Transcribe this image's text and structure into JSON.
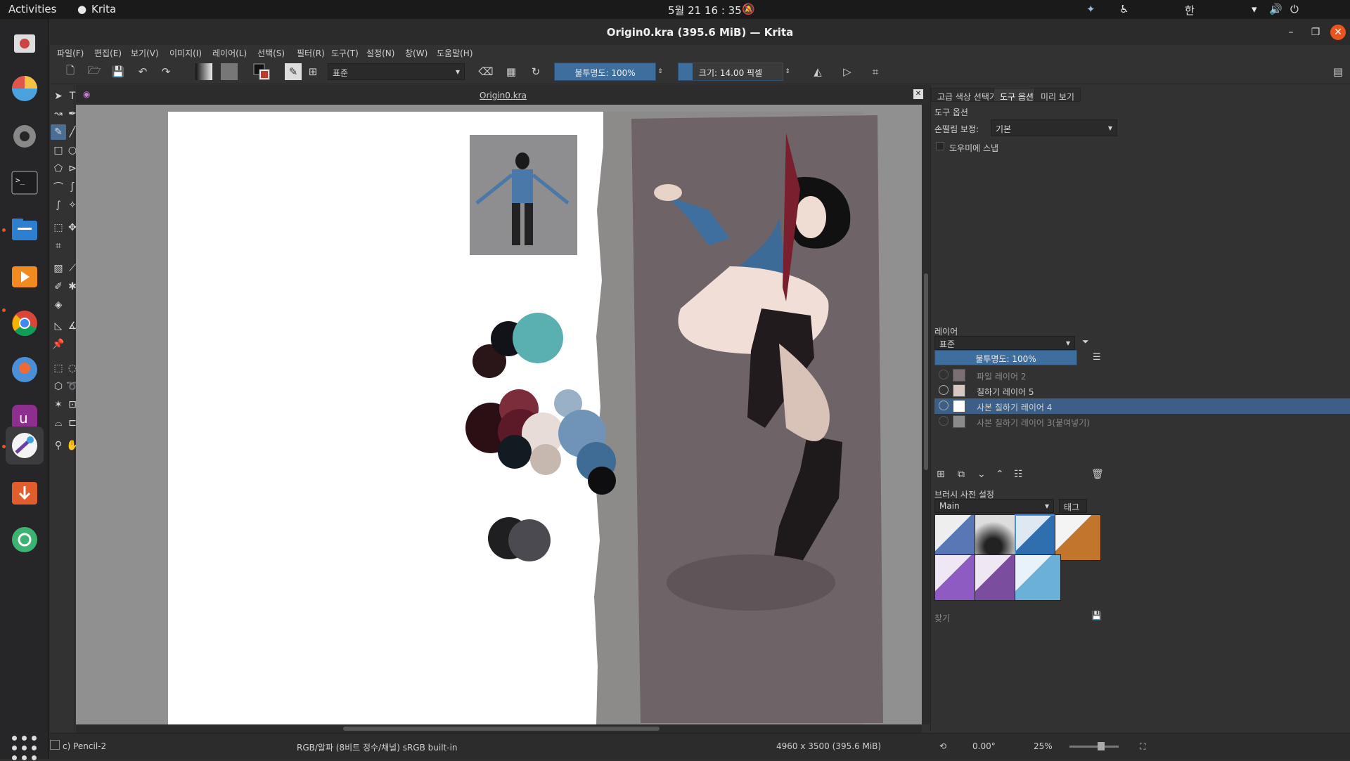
{
  "topbar": {
    "activities": "Activities",
    "app_name": "Krita",
    "clock": "5월 21  16 : 35",
    "input_method": "한"
  },
  "window": {
    "title": "Origin0.kra (395.6 MiB) — Krita"
  },
  "menu": [
    "파일(F)",
    "편집(E)",
    "보기(V)",
    "이미지(I)",
    "레이어(L)",
    "선택(S)",
    "필터(R)",
    "도구(T)",
    "설정(N)",
    "창(W)",
    "도움말(H)"
  ],
  "toolbar": {
    "blend_mode": "표준",
    "opacity_label": "불투명도: 100%",
    "size_label": "크기: 14.00 픽셀"
  },
  "document": {
    "tab_title": "Origin0.kra"
  },
  "panel": {
    "tabs": [
      "고급 색상 선택기",
      "도구 옵션",
      "미리 보기"
    ],
    "active_tab": "도구 옵션",
    "tool_options_title": "도구 옵션",
    "smoothing_label": "손떨림 보정:",
    "smoothing_value": "기본",
    "snap_label": "도우미에 스냅",
    "layers_title": "레이어",
    "layer_blend_mode": "표준",
    "layer_opacity": "불투명도:  100%",
    "layers": [
      {
        "name": "파일 레이어 2",
        "visible": false
      },
      {
        "name": "칠하기 레이어 5",
        "visible": true
      },
      {
        "name": "사본 칠하기 레이어 4",
        "visible": true,
        "selected": true
      },
      {
        "name": "사본 칠하기 레이어 3(붙여넣기)",
        "visible": false
      }
    ],
    "brush_presets_title": "브러시 사전 설정",
    "brush_preset_group": "Main",
    "tag_label": "태그",
    "search_placeholder": "찾기"
  },
  "status": {
    "brush_name": "c) Pencil-2",
    "color_space": "RGB/알파 (8비트 정수/채널)  sRGB built-in",
    "image_size": "4960 x 3500 (395.6 MiB)",
    "rotation": "0.00°",
    "zoom": "25%"
  },
  "colors": {
    "accent": "#3e6e9e",
    "selection": "#3b5f86",
    "close_button": "#e95420"
  }
}
